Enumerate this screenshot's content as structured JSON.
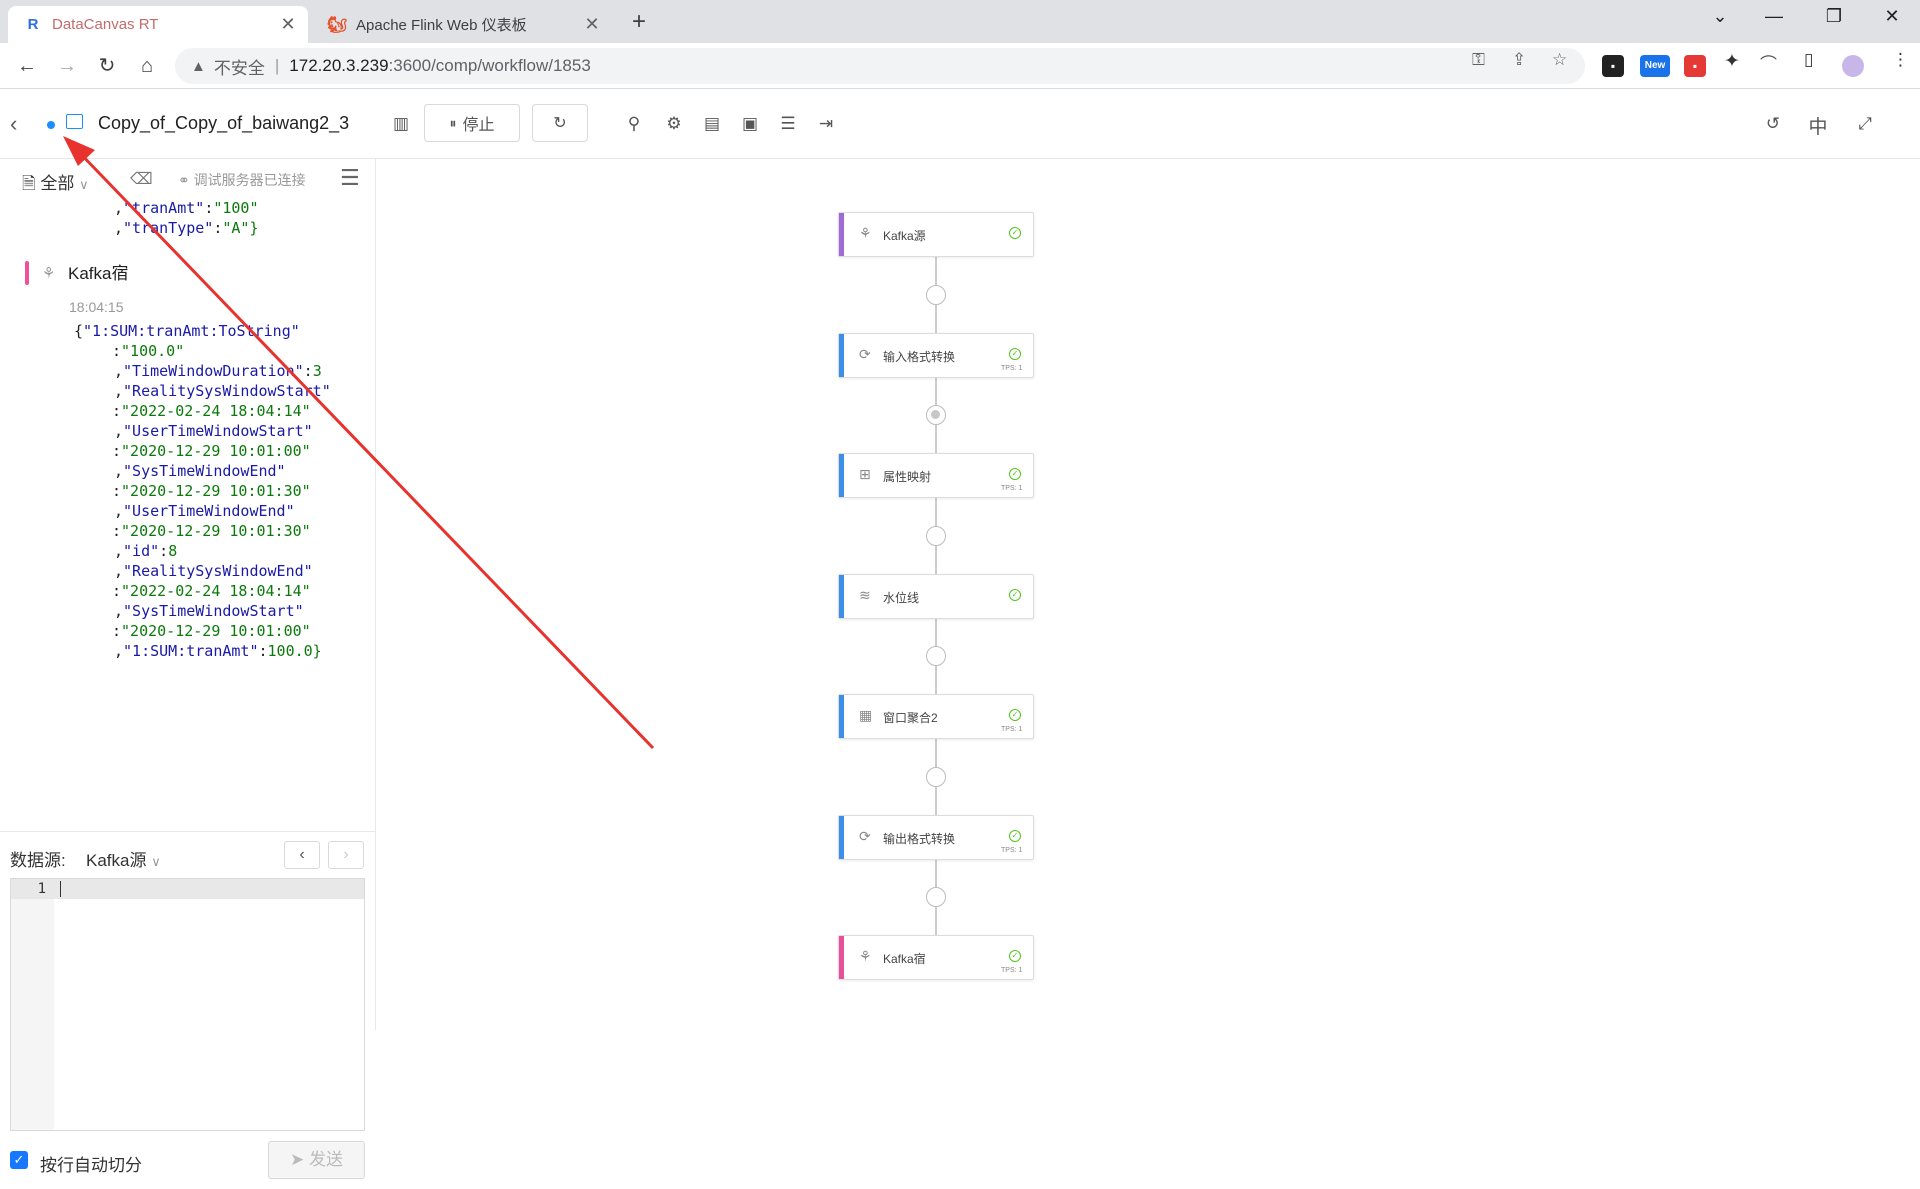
{
  "browser": {
    "tabs": [
      {
        "title": "DataCanvas RT",
        "favicon": "R",
        "active": true
      },
      {
        "title": "Apache Flink Web 仪表板",
        "favicon": "flink-icon",
        "active": false
      }
    ],
    "address": {
      "insecure_label": "不安全",
      "separator": "|",
      "host": "172.20.3.239",
      "path": ":3600/comp/workflow/1853"
    },
    "extension_new_badge": "New"
  },
  "header": {
    "title": "Copy_of_Copy_of_baiwang2_3",
    "stop_label": "停止",
    "lang_label": "中"
  },
  "left_panel": {
    "filter_label": "全部",
    "server_status": "调试服务器已连接",
    "log": {
      "prev_lines": [
        [
          ",",
          "\"tranAmt\"",
          ":",
          "\"100\""
        ],
        [
          ",",
          "\"tranType\"",
          ":",
          "\"A\"}"
        ]
      ],
      "node_name": "Kafka宿",
      "timestamp": "18:04:15",
      "lines": [
        [
          "{",
          "\"1:SUM:tranAmt:ToString\"",
          "",
          ""
        ],
        [
          "",
          "",
          ":",
          "\"100.0\""
        ],
        [
          ",",
          "\"TimeWindowDuration\"",
          ":",
          "3"
        ],
        [
          ",",
          "\"RealitySysWindowStart\"",
          "",
          ""
        ],
        [
          "",
          "",
          ":",
          "\"2022-02-24 18:04:14\""
        ],
        [
          ",",
          "\"UserTimeWindowStart\"",
          "",
          ""
        ],
        [
          "",
          "",
          ":",
          "\"2020-12-29 10:01:00\""
        ],
        [
          ",",
          "\"SysTimeWindowEnd\"",
          "",
          ""
        ],
        [
          "",
          "",
          ":",
          "\"2020-12-29 10:01:30\""
        ],
        [
          ",",
          "\"UserTimeWindowEnd\"",
          "",
          ""
        ],
        [
          "",
          "",
          ":",
          "\"2020-12-29 10:01:30\""
        ],
        [
          ",",
          "\"id\"",
          ":",
          "8"
        ],
        [
          ",",
          "\"RealitySysWindowEnd\"",
          "",
          ""
        ],
        [
          "",
          "",
          ":",
          "\"2022-02-24 18:04:14\""
        ],
        [
          ",",
          "\"SysTimeWindowStart\"",
          "",
          ""
        ],
        [
          "",
          "",
          ":",
          "\"2020-12-29 10:01:00\""
        ],
        [
          ",",
          "\"1:SUM:tranAmt\"",
          ":",
          "100.0}"
        ]
      ]
    },
    "source_label": "数据源:",
    "source_value": "Kafka源",
    "editor_line": "1",
    "auto_split_label": "按行自动切分",
    "send_label": "发送"
  },
  "workflow": {
    "nodes": [
      {
        "label": "Kafka源",
        "icon": "kafka-icon",
        "color": "#a06bd6",
        "tps": ""
      },
      {
        "label": "输入格式转换",
        "icon": "convert-icon",
        "color": "#3b8fe6",
        "tps": "TPS: 1"
      },
      {
        "label": "属性映射",
        "icon": "mapping-icon",
        "color": "#3b8fe6",
        "tps": "TPS: 1"
      },
      {
        "label": "水位线",
        "icon": "watermark-icon",
        "color": "#3b8fe6",
        "tps": ""
      },
      {
        "label": "窗口聚合2",
        "icon": "window-icon",
        "color": "#3b8fe6",
        "tps": "TPS: 1"
      },
      {
        "label": "输出格式转换",
        "icon": "convert-icon",
        "color": "#3b8fe6",
        "tps": "TPS: 1"
      },
      {
        "label": "Kafka宿",
        "icon": "kafka-icon",
        "color": "#e8509b",
        "tps": "TPS: 1"
      }
    ],
    "active_port_index": 1
  },
  "colors": {
    "accent": "#1890ff",
    "annotation_arrow": "#e8322e"
  }
}
